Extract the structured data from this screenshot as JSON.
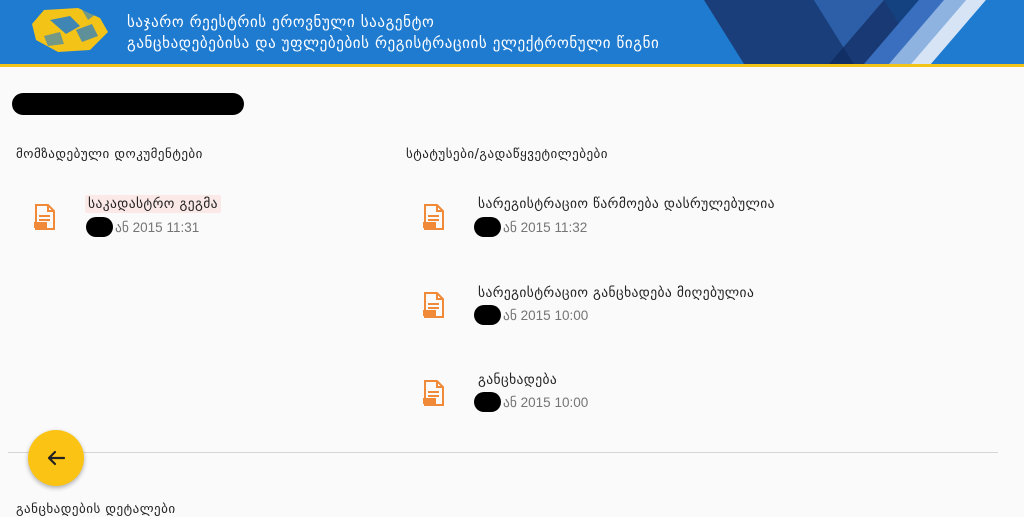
{
  "header": {
    "title_line1": "საჯარო რეესტრის ეროვნული სააგენტო",
    "title_line2": "განცხადებებისა და უფლებების რეგისტრაციის ელექტრონული წიგნი"
  },
  "prepared_documents": {
    "heading": "მომზადებული დოკუმენტები",
    "items": [
      {
        "title": "საკადასტრო გეგმა",
        "date": "ან 2015 11:31"
      }
    ]
  },
  "statuses": {
    "heading": "სტატუსები/გადაწყვეტილებები",
    "items": [
      {
        "title": "სარეგისტრაციო წარმოება დასრულებულია",
        "date": "ან 2015 11:32"
      },
      {
        "title": "სარეგისტრაციო განცხადება მიღებულია",
        "date": "ან 2015 10:00"
      },
      {
        "title": "განცხადება",
        "date": "ან 2015 10:00"
      }
    ]
  },
  "bottom_section": {
    "heading": "განცხადების დეტალები"
  },
  "colors": {
    "header": "#1e7bd0",
    "accent": "#f3c318",
    "icon": "#f08a38",
    "fab": "#fbc313"
  },
  "icons": {
    "document": "document-icon",
    "back": "arrow-left-icon"
  }
}
